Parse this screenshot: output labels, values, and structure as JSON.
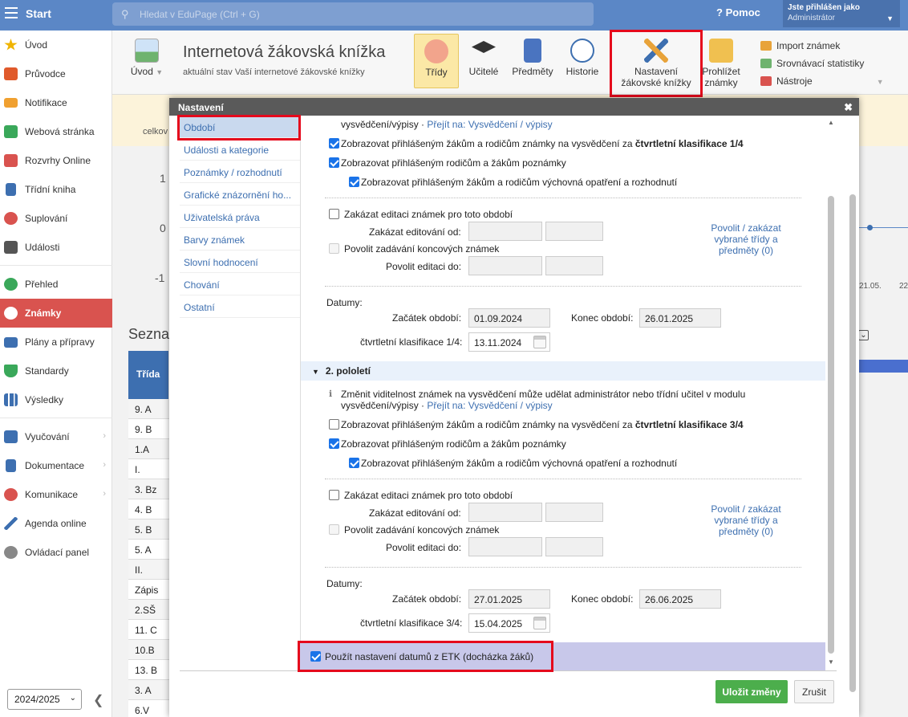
{
  "topbar": {
    "start": "Start",
    "search_placeholder": "Hledat v EduPage (Ctrl + G)",
    "help": "Pomoc",
    "user_line1": "Jste přihlášen jako",
    "user_line2": "Administrátor"
  },
  "sidebar": {
    "items": [
      {
        "label": "Úvod",
        "icon": "star-icon",
        "color": "#f0b400"
      },
      {
        "label": "Průvodce",
        "icon": "wand-icon",
        "color": "#e05a2b"
      },
      {
        "label": "Notifikace",
        "icon": "envelope-icon",
        "color": "#f0a030"
      },
      {
        "label": "Webová stránka",
        "icon": "home-icon",
        "color": "#3aa85a"
      },
      {
        "label": "Rozvrhy Online",
        "icon": "grid-icon",
        "color": "#d9534f"
      },
      {
        "label": "Třídní kniha",
        "icon": "book-icon",
        "color": "#3d6fb0"
      },
      {
        "label": "Suplování",
        "icon": "person-icon",
        "color": "#d9534f"
      },
      {
        "label": "Události",
        "icon": "calendar-icon",
        "color": "#555"
      },
      {
        "label": "Přehled",
        "icon": "check-circle-icon",
        "color": "#3aa85a"
      },
      {
        "label": "Známky",
        "icon": "grade-icon",
        "color": "#fff"
      },
      {
        "label": "Plány a přípravy",
        "icon": "briefcase-icon",
        "color": "#3d6fb0"
      },
      {
        "label": "Standardy",
        "icon": "shield-icon",
        "color": "#3aa85a"
      },
      {
        "label": "Výsledky",
        "icon": "bar-chart-icon",
        "color": "#3d6fb0"
      },
      {
        "label": "Vyučování",
        "icon": "books-icon",
        "color": "#3d6fb0"
      },
      {
        "label": "Dokumentace",
        "icon": "document-icon",
        "color": "#3d6fb0"
      },
      {
        "label": "Komunikace",
        "icon": "chat-icon",
        "color": "#d9534f"
      },
      {
        "label": "Agenda online",
        "icon": "pen-icon",
        "color": "#3d6fb0"
      },
      {
        "label": "Ovládací panel",
        "icon": "gear-icon",
        "color": "#888"
      }
    ],
    "year": "2024/2025"
  },
  "ribbon": {
    "uvod": "Úvod",
    "title": "Internetová žákovská knížka",
    "subtitle": "aktuální stav Vaší internetové žákovské knížky",
    "tridy": "Třídy",
    "ucitele": "Učitelé",
    "predmety": "Předměty",
    "historie": "Historie",
    "nastaveni_l1": "Nastavení",
    "nastaveni_l2": "žákovské knížky",
    "prohlizet_l1": "Prohlížet",
    "prohlizet_l2": "známky",
    "import": "Import známek",
    "srovnavaci": "Srovnávací statistiky",
    "nastroje": "Nástroje"
  },
  "background": {
    "celkov": "celkov",
    "n1": "1",
    "n0": "0",
    "nm1": "-1",
    "date1": "21.05.",
    "date2": "22",
    "seznam": "Sezna",
    "table_header": "Třída",
    "rows": [
      "9. A",
      "9. B",
      "1.A",
      "I.",
      "3. Bz",
      "4. B",
      "5. B",
      "5. A",
      "II.",
      "Zápis",
      "2.SŠ",
      "11. C",
      "10.B",
      "13. B",
      "3. A",
      "6.V"
    ]
  },
  "modal": {
    "title": "Nastavení",
    "nav": [
      "Období",
      "Události a kategorie",
      "Poznámky / rozhodnutí",
      "Grafické znázornění ho...",
      "Uživatelská práva",
      "Barvy známek",
      "Slovní hodnocení",
      "Chování",
      "Ostatní"
    ],
    "p1": {
      "top_text": "vysvědčení/výpisy ·",
      "top_link": "Přejít na: Vysvědčení / výpisy",
      "cb1_pre": "Zobrazovat přihlášeným žákům a rodičům známky na vysvědčení za ",
      "cb1_bold": "čtvrtletní klasifikace 1/4",
      "cb2": "Zobrazovat přihlášeným rodičům a žákům poznámky",
      "cb3": "Zobrazovat přihlášeným žákům a rodičům výchovná opatření a rozhodnutí",
      "zakazat": "Zakázat editaci známek pro toto období",
      "zakazat_od": "Zakázat editování od:",
      "povolit_konc": "Povolit zadávání koncových známek",
      "povolit_do": "Povolit editaci do:",
      "side_link": "Povolit / zakázat vybrané třídy a předměty (0)",
      "datumy": "Datumy:",
      "zacatek_lbl": "Začátek období:",
      "zacatek": "01.09.2024",
      "konec_lbl": "Konec období:",
      "konec": "26.01.2025",
      "ctvrt_lbl": "čtvrtletní klasifikace 1/4:",
      "ctvrt": "13.11.2024"
    },
    "section2": "2. pololetí",
    "p2": {
      "info": "Změnit viditelnost známek na vysvědčení může udělat administrátor nebo třídní učitel v modulu",
      "top_text": "vysvědčení/výpisy ·",
      "top_link": "Přejít na: Vysvědčení / výpisy",
      "cb1_pre": "Zobrazovat přihlášeným žákům a rodičům známky na vysvědčení za ",
      "cb1_bold": "čtvrtletní klasifikace 3/4",
      "cb2": "Zobrazovat přihlášeným rodičům a žákům poznámky",
      "cb3": "Zobrazovat přihlášeným žákům a rodičům výchovná opatření a rozhodnutí",
      "zakazat": "Zakázat editaci známek pro toto období",
      "zakazat_od": "Zakázat editování od:",
      "povolit_konc": "Povolit zadávání koncových známek",
      "povolit_do": "Povolit editaci do:",
      "side_link": "Povolit / zakázat vybrané třídy a předměty (0)",
      "datumy": "Datumy:",
      "zacatek_lbl": "Začátek období:",
      "zacatek": "27.01.2025",
      "konec_lbl": "Konec období:",
      "konec": "26.06.2025",
      "ctvrt_lbl": "čtvrtletní klasifikace 3/4:",
      "ctvrt": "15.04.2025"
    },
    "etk": "Použít nastavení datumů z ETK (docházka žáků)",
    "save": "Uložit změny",
    "cancel": "Zrušit"
  }
}
